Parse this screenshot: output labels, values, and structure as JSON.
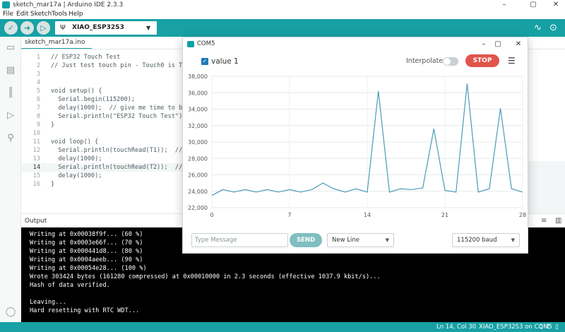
{
  "window": {
    "title": "sketch_mar17a | Arduino IDE 2.3.3",
    "controls": [
      "–",
      "▢",
      "✕"
    ]
  },
  "menu": [
    "File",
    "Edit",
    "Sketch",
    "Tools",
    "Help"
  ],
  "toolbar": {
    "verify_icon": "check-icon",
    "upload_icon": "arrow-right-icon",
    "debug_icon": "debugger-icon",
    "board": "XIAO_ESP32S3",
    "plotter_icon": "serial-plotter-icon",
    "monitor_icon": "serial-monitor-icon"
  },
  "editor": {
    "tab": "sketch_mar17a.ino",
    "current_line": 14,
    "lines": [
      {
        "n": "1",
        "text": "// ESP32 Touch Test"
      },
      {
        "n": "2",
        "text": "// Just test touch pin - Touch0 is T0 w"
      },
      {
        "n": "3",
        "text": ""
      },
      {
        "n": "4",
        "text": ""
      },
      {
        "n": "5",
        "text": "void setup() {"
      },
      {
        "n": "6",
        "text": "  Serial.begin(115200);"
      },
      {
        "n": "7",
        "text": "  delay(1000);  // give me time to brin"
      },
      {
        "n": "8",
        "text": "  Serial.println(\"ESP32 Touch Test\");"
      },
      {
        "n": "9",
        "text": "}"
      },
      {
        "n": "10",
        "text": ""
      },
      {
        "n": "11",
        "text": "void loop() {"
      },
      {
        "n": "12",
        "text": "  Serial.println(touchRead(T1));  // ge"
      },
      {
        "n": "13",
        "text": "  delay(1000);"
      },
      {
        "n": "14",
        "text": "  Serial.println(touchRead(T2));  // ge"
      },
      {
        "n": "15",
        "text": "  delay(1000);"
      },
      {
        "n": "16",
        "text": "}"
      }
    ]
  },
  "output": {
    "label": "Output",
    "lines": [
      "Writing at 0x00038f9f... (60 %)",
      "Writing at 0x0003e66f... (70 %)",
      "Writing at 0x000441d8... (80 %)",
      "Writing at 0x0004aeeb... (90 %)",
      "Writing at 0x00054e28... (100 %)",
      "Wrote 303424 bytes (161280 compressed) at 0x00010000 in 2.3 seconds (effective 1037.9 kbit/s)...",
      "Hash of data verified.",
      "",
      "Leaving...",
      "Hard resetting with RTC WDT..."
    ]
  },
  "status": {
    "position": "Ln 14, Col 30",
    "board": "XIAO_ESP32S3 on COM5",
    "notifications": "2"
  },
  "plotter": {
    "title": "COM5",
    "series_label": "value 1",
    "interpolate_label": "Interpolate",
    "interpolate": false,
    "stop_label": "STOP",
    "message_placeholder": "Type Message",
    "send_label": "SEND",
    "line_ending": "New Line",
    "baud": "115200 baud",
    "line_color": "#4a9bb8"
  },
  "chart_data": {
    "type": "line",
    "x": [
      0,
      1,
      2,
      3,
      4,
      5,
      6,
      7,
      8,
      9,
      10,
      11,
      12,
      13,
      14,
      15,
      16,
      17,
      18,
      19,
      20,
      21,
      22,
      23,
      24,
      25,
      26,
      27,
      28
    ],
    "series": [
      {
        "values": [
          23500,
          24200,
          23900,
          24200,
          23900,
          24200,
          23900,
          24200,
          23900,
          24200,
          25000,
          24300,
          23900,
          24300,
          23900,
          36200,
          23900,
          24300,
          24200,
          24400,
          31600,
          24100,
          23900,
          37100,
          23900,
          24300,
          34100,
          24300,
          23900
        ]
      }
    ],
    "xlim": [
      0,
      28
    ],
    "ylim": [
      22000,
      38000
    ],
    "x_ticks": [
      0,
      7,
      14,
      21,
      28
    ],
    "y_ticks": [
      22000,
      24000,
      26000,
      28000,
      30000,
      32000,
      34000,
      36000,
      38000
    ],
    "y_tick_labels": [
      "22,000",
      "24,000",
      "26,000",
      "28,000",
      "30,000",
      "32,000",
      "34,000",
      "36,000",
      "38,000"
    ],
    "grid": true
  }
}
